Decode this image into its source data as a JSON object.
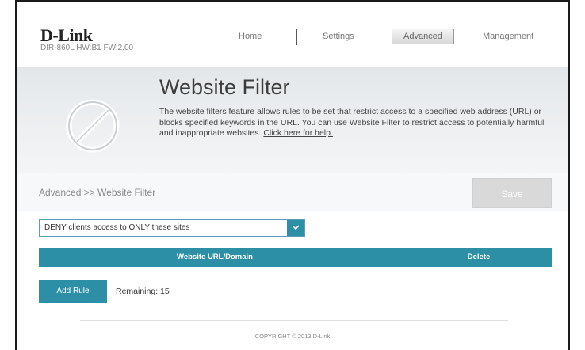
{
  "header": {
    "logo": "D-Link",
    "model": "DIR-860L  HW:B1  FW:2.00"
  },
  "nav": {
    "home": "Home",
    "settings": "Settings",
    "advanced": "Advanced",
    "management": "Management"
  },
  "banner": {
    "title": "Website Filter",
    "description": "The website filters feature allows rules to be set that restrict access to a specified web address (URL) or blocks specified keywords in the URL. You can use Website Filter to restrict access to potentially harmful and inappropriate websites.",
    "help_link": "Click here for help."
  },
  "breadcrumb": "Advanced >> Website Filter",
  "save_label": "Save",
  "filter_mode": {
    "selected": "DENY clients access to ONLY these sites"
  },
  "table": {
    "columns": [
      "Website URL/Domain",
      "Delete"
    ]
  },
  "add_rule_label": "Add Rule",
  "remaining": "Remaining: 15",
  "footer": "COPYRIGHT © 2013 D-Link",
  "colors": {
    "accent": "#2d8fa6",
    "save_disabled": "#d9d9d9"
  },
  "icons": {
    "banner": "no-entry-icon",
    "select_arrow": "chevron-down-icon"
  }
}
